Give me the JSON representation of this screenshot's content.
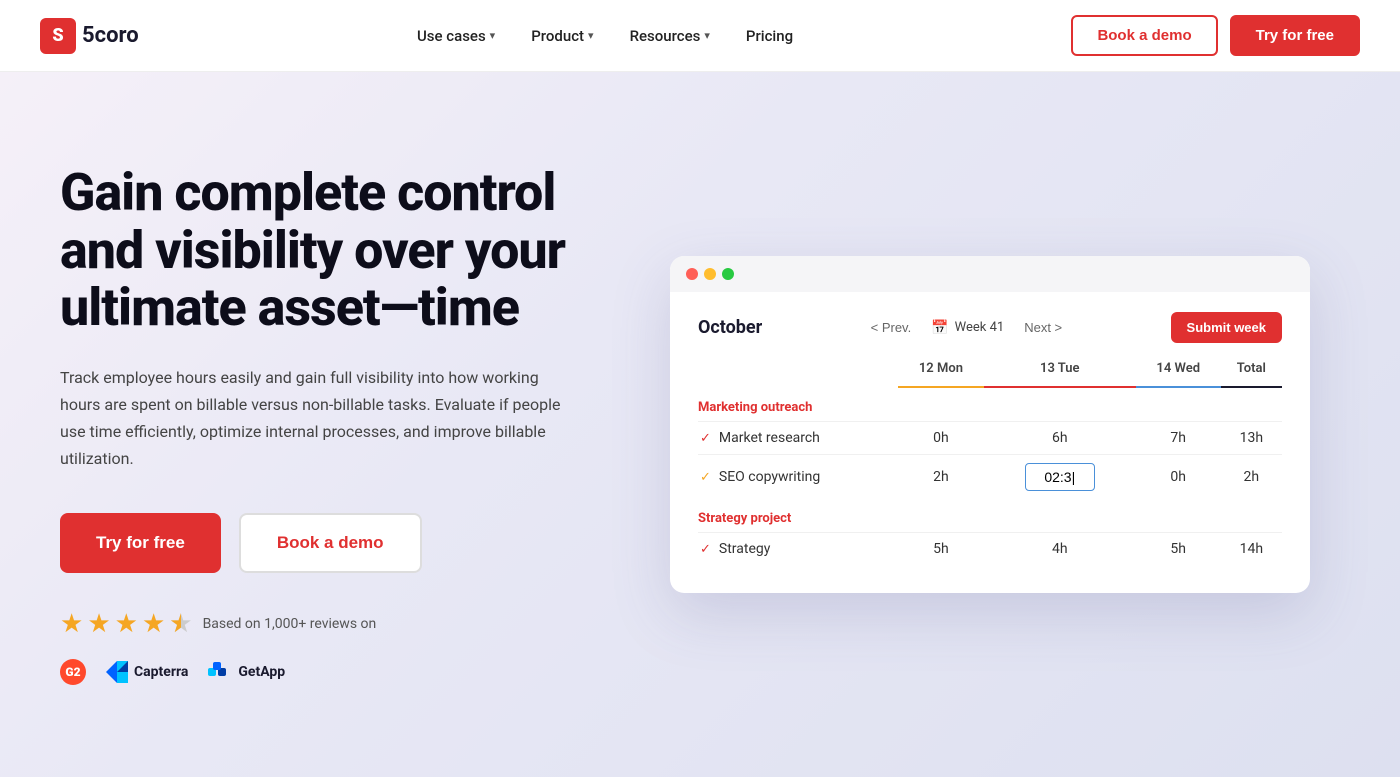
{
  "nav": {
    "logo_letter": "S",
    "logo_name": "5coro",
    "links": [
      {
        "label": "Use cases",
        "has_dropdown": true
      },
      {
        "label": "Product",
        "has_dropdown": true
      },
      {
        "label": "Resources",
        "has_dropdown": true
      },
      {
        "label": "Pricing",
        "has_dropdown": false
      }
    ],
    "book_demo": "Book a demo",
    "try_free": "Try for free"
  },
  "hero": {
    "heading": "Gain complete control and visibility over your ultimate asset—time",
    "subtext": "Track employee hours easily and gain full visibility into how working hours are spent on billable versus non-billable tasks. Evaluate if people use time efficiently, optimize internal processes, and improve billable utilization.",
    "btn_free": "Try for free",
    "btn_demo": "Book a demo",
    "review_text": "Based on 1,000+ reviews on",
    "logos": [
      {
        "name": "G2",
        "label": ""
      },
      {
        "name": "Capterra",
        "label": "Capterra"
      },
      {
        "name": "GetApp",
        "label": "GetApp"
      }
    ]
  },
  "dashboard": {
    "month": "October",
    "nav_prev": "< Prev.",
    "nav_week": "Week 41",
    "nav_next": "Next >",
    "submit_btn": "Submit week",
    "columns": [
      "",
      "12 Mon",
      "13 Tue",
      "14 Wed",
      "Total"
    ],
    "sections": [
      {
        "label": "Marketing outreach",
        "rows": [
          {
            "task": "Market research",
            "check": true,
            "mon": "0h",
            "tue": "6h",
            "wed": "7h",
            "total": "13h",
            "editing": false
          },
          {
            "task": "SEO copywriting",
            "check": true,
            "mon": "2h",
            "tue": "02:3|",
            "wed": "0h",
            "total": "2h",
            "editing": true
          }
        ]
      },
      {
        "label": "Strategy project",
        "rows": [
          {
            "task": "Strategy",
            "check": true,
            "mon": "5h",
            "tue": "4h",
            "wed": "5h",
            "total": "14h",
            "editing": false
          }
        ]
      }
    ]
  }
}
